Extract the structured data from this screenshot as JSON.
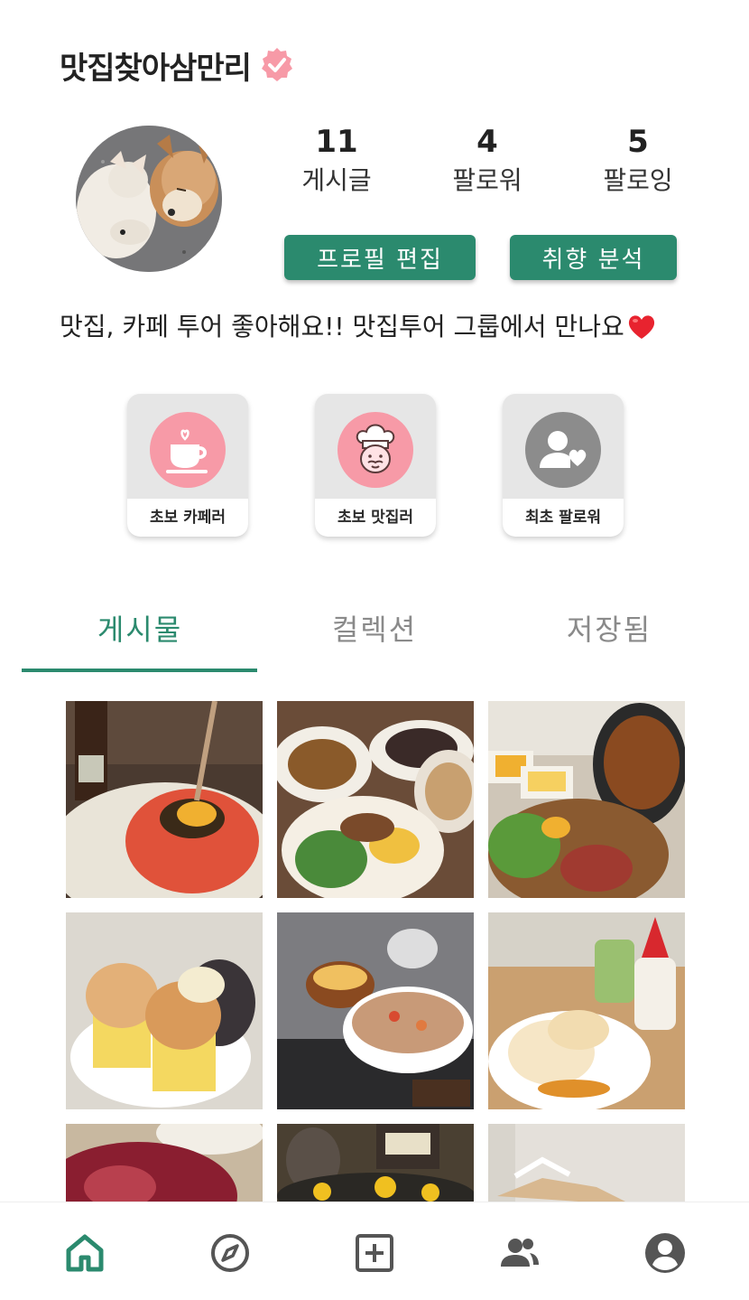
{
  "profile": {
    "username": "맛집찾아삼만리",
    "verified_icon": "verified-badge-icon",
    "bio": "맛집, 카페 투어 좋아해요!! 맛집투어 그룹에서 만나요",
    "bio_emoji": "heart-icon"
  },
  "stats": [
    {
      "value": "11",
      "label": "게시글"
    },
    {
      "value": "4",
      "label": "팔로워"
    },
    {
      "value": "5",
      "label": "팔로잉"
    }
  ],
  "buttons": {
    "edit_profile": "프로필 편집",
    "taste_analysis": "취향 분석"
  },
  "badges": [
    {
      "label": "초보 카페러",
      "icon": "coffee-cup-icon"
    },
    {
      "label": "초보 맛집러",
      "icon": "chef-icon"
    },
    {
      "label": "최초 팔로워",
      "icon": "user-heart-icon"
    }
  ],
  "tabs": [
    {
      "label": "게시물",
      "active": true
    },
    {
      "label": "컬렉션",
      "active": false
    },
    {
      "label": "저장됨",
      "active": false
    }
  ],
  "nav": [
    "home-icon",
    "compass-icon",
    "add-post-icon",
    "group-icon",
    "account-icon"
  ],
  "colors": {
    "accent": "#2b8a6e",
    "badge_pink": "#f79aa7",
    "badge_gray": "#8c8c8c",
    "tab_inactive": "#8a8a8a"
  }
}
